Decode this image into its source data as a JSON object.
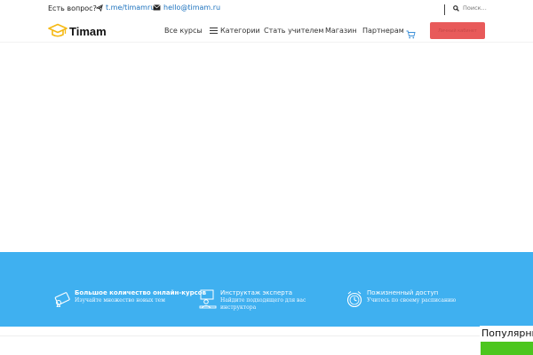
{
  "topbar": {
    "question": "Есть вопрос?",
    "telegram": "t.me/timamru",
    "email": "hello@timam.ru",
    "search_placeholder": "Поиск..."
  },
  "nav": {
    "logo": "Timam",
    "all_courses": "Все курсы",
    "categories": "Категории",
    "become_teacher": "Стать учителем",
    "shop": "Магазин",
    "partners": "Партнерам",
    "login": "Личный кабинет"
  },
  "features": [
    {
      "title": "Большое количество онлайн-курсов",
      "sub": "Изучайте множество новых тем"
    },
    {
      "title": "Инструктаж эксперта",
      "sub": "Найдите подходящего для вас инструктора"
    },
    {
      "title": "Пожизненный доступ",
      "sub": "Учитесь по своему расписанию"
    }
  ],
  "popular": "Популярные",
  "colors": {
    "accent": "#3fb0f0",
    "login": "#e85a5a",
    "green": "#4cc61e",
    "logo": "#f5b914"
  }
}
